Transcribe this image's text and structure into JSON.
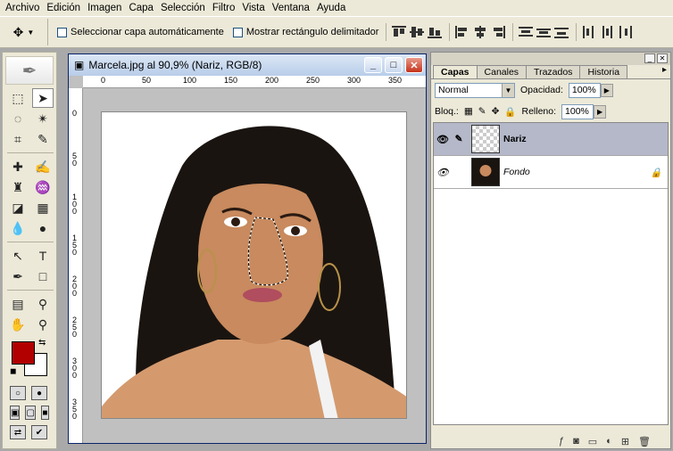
{
  "menu": [
    "Archivo",
    "Edición",
    "Imagen",
    "Capa",
    "Selección",
    "Filtro",
    "Vista",
    "Ventana",
    "Ayuda"
  ],
  "options": {
    "auto_select_label": "Seleccionar capa automáticamente",
    "bounding_box_label": "Mostrar rectángulo delimitador"
  },
  "document": {
    "title": "Marcela.jpg al 90,9% (Nariz, RGB/8)",
    "ruler_h": [
      "0",
      "50",
      "100",
      "150",
      "200",
      "250",
      "300",
      "350"
    ],
    "ruler_v": [
      "0",
      "5\n0",
      "1\n0\n0",
      "1\n5\n0",
      "2\n0\n0",
      "2\n5\n0",
      "3\n0\n0",
      "3\n5\n0"
    ]
  },
  "colors": {
    "foreground": "#b20000",
    "background": "#ffffff"
  },
  "panel": {
    "tabs": [
      "Capas",
      "Canales",
      "Trazados",
      "Historia"
    ],
    "blend_mode": "Normal",
    "opacity_label": "Opacidad:",
    "opacity_value": "100%",
    "lock_label": "Bloq.:",
    "fill_label": "Relleno:",
    "fill_value": "100%",
    "layers": [
      {
        "name": "Nariz",
        "active": true
      },
      {
        "name": "Fondo",
        "active": false
      }
    ]
  }
}
